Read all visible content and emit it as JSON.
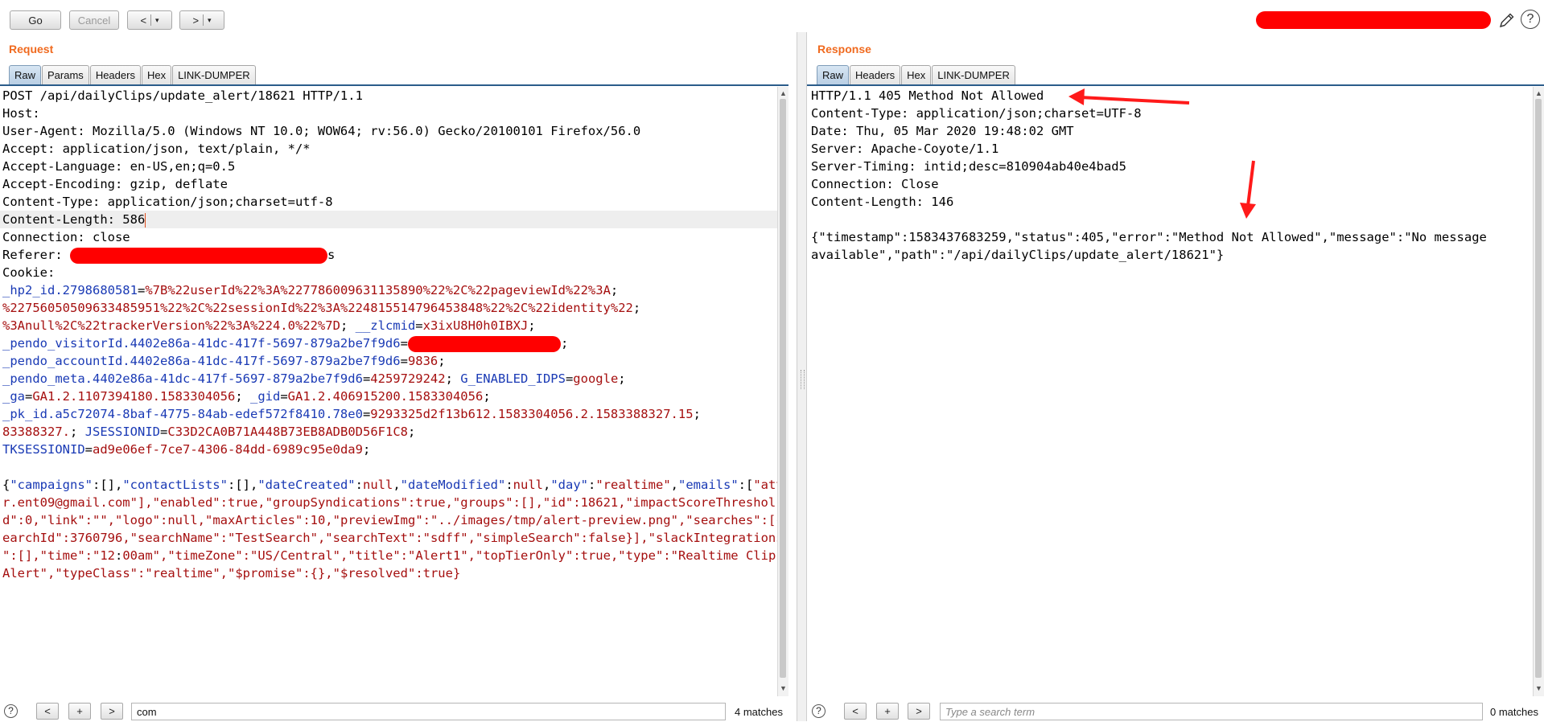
{
  "toolbar": {
    "go_label": "Go",
    "cancel_label": "Cancel",
    "back_label": "<",
    "forward_label": ">",
    "dropdown_glyph": "▾",
    "help_glyph": "?"
  },
  "request": {
    "title": "Request",
    "tabs": [
      "Raw",
      "Params",
      "Headers",
      "Hex",
      "LINK-DUMPER"
    ],
    "active_tab": "Raw",
    "lines": [
      {
        "t": "POST /api/dailyClips/update_alert/18621 HTTP/1.1"
      },
      {
        "t": "Host: "
      },
      {
        "t": "User-Agent: Mozilla/5.0 (Windows NT 10.0; WOW64; rv:56.0) Gecko/20100101 Firefox/56.0"
      },
      {
        "t": "Accept: application/json, text/plain, */*"
      },
      {
        "t": "Accept-Language: en-US,en;q=0.5"
      },
      {
        "t": "Accept-Encoding: gzip, deflate"
      },
      {
        "t": "Content-Type: application/json;charset=utf-8"
      },
      {
        "t": "Content-Length: 586"
      },
      {
        "t": "Connection: close"
      },
      {
        "t": "Referer: ",
        "tail": "s"
      },
      {
        "t": "Cookie:"
      }
    ],
    "cookies": [
      {
        "k": "_hp2_id.2798680581",
        "v": "%7B%22userId%22%3A%227786009631135890%22%2C%22pageviewId%22%3A"
      },
      {
        "v": "%22756050509633485951%22%2C%22sessionId%22%3A%224815514796453848%22%2C%22identity%22"
      },
      {
        "v": "%3Anull%2C%22trackerVersion%22%3A%224.0%22%7D",
        "k2": "__zlcmid",
        "v2": "x3ixU8H0h0IBXJ"
      },
      {
        "k": "_pendo_visitorId.4402e86a-41dc-417f-5697-879a2be7f9d6"
      },
      {
        "k": "_pendo_accountId.4402e86a-41dc-417f-5697-879a2be7f9d6",
        "v": "9836"
      },
      {
        "k": "_pendo_meta.4402e86a-41dc-417f-5697-879a2be7f9d6",
        "v": "4259729242",
        "k2": "G_ENABLED_IDPS",
        "v2": "google"
      },
      {
        "k": "_ga",
        "v": "GA1.2.1107394180.1583304056",
        "k2": "_gid",
        "v2": "GA1.2.406915200.1583304056"
      },
      {
        "k": "_pk_id.a5c72074-8baf-4775-84ab-edef572f8410.78e0",
        "v": "9293325d2f13b612.1583304056.2.1583388327.15"
      },
      {
        "v": "83388327.",
        "k2": "JSESSIONID",
        "v2": "C33D2CA0B71A448B73EB8ADB0D56F1C8"
      },
      {
        "k": "TKSESSIONID",
        "v": "ad9e06ef-7ce7-4306-84dd-6989c95e0da9"
      }
    ],
    "body_lines": [
      "{\"campaigns\":[],\"contactLists\":[],\"dateCreated\":null,\"dateModified\":null,\"day\":\"realtime\",\"emails\":[\"attacke",
      "r.ent09@gmail.com\"],\"enabled\":true,\"groupSyndications\":true,\"groups\":[],\"id\":18621,\"impactScoreThreshol",
      "d\":0,\"link\":\"\",\"logo\":null,\"maxArticles\":10,\"previewImg\":\"../images/tmp/alert-preview.png\",\"searches\":[{\"s",
      "earchId\":3760796,\"searchName\":\"TestSearch\",\"searchText\":\"sdff\",\"simpleSearch\":false}],\"slackIntegrations",
      "\":[],\"time\":\"12:00am\",\"timeZone\":\"US/Central\",\"title\":\"Alert1\",\"topTierOnly\":true,\"type\":\"Realtime Clip",
      "Alert\",\"typeClass\":\"realtime\",\"$promise\":{},\"$resolved\":true}"
    ],
    "search": {
      "value": "com",
      "placeholder": "Type a search term",
      "matches": "4 matches"
    }
  },
  "response": {
    "title": "Response",
    "tabs": [
      "Raw",
      "Headers",
      "Hex",
      "LINK-DUMPER"
    ],
    "active_tab": "Raw",
    "lines": [
      "HTTP/1.1 405 Method Not Allowed",
      "Content-Type: application/json;charset=UTF-8",
      "Date: Thu, 05 Mar 2020 19:48:02 GMT",
      "Server: Apache-Coyote/1.1",
      "Server-Timing: intid;desc=810904ab40e4bad5",
      "Connection: Close",
      "Content-Length: 146",
      "",
      "{\"timestamp\":1583437683259,\"status\":405,\"error\":\"Method Not Allowed\",\"message\":\"No message",
      "available\",\"path\":\"/api/dailyClips/update_alert/18621\"}"
    ],
    "search": {
      "value": "",
      "placeholder": "Type a search term",
      "matches": "0 matches"
    }
  },
  "colors": {
    "accent_title": "#f06a1f",
    "redaction": "#ff0000",
    "json_key": "#1a3ab5",
    "json_value": "#a50f0f",
    "highlight": "#ffee6a"
  },
  "icons": [
    "edit-pencil-icon",
    "help-icon",
    "scroll-up-icon",
    "scroll-down-icon",
    "annotation-arrow"
  ]
}
